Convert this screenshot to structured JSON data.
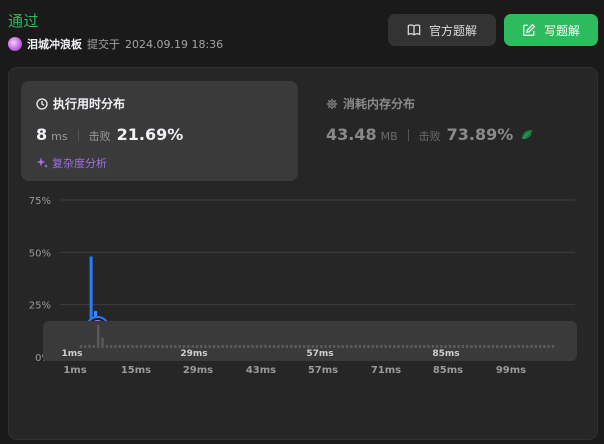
{
  "header": {
    "status": "通过",
    "username": "泪城冲浪板",
    "submitted_label": "提交于",
    "submitted_at": "2024.09.19 18:36",
    "official_solution_label": "官方题解",
    "write_solution_label": "写题解"
  },
  "runtime_card": {
    "title": "执行用时分布",
    "value": "8",
    "unit": "ms",
    "beats_label": "击败",
    "beats_value": "21.69%",
    "complexity_label": "复杂度分析"
  },
  "memory_card": {
    "title": "消耗内存分布",
    "value": "43.48",
    "unit": "MB",
    "beats_label": "击败",
    "beats_value": "73.89%"
  },
  "colors": {
    "accent_green": "#2cbb5d",
    "bar_blue": "#2b7df6",
    "purple": "#a06fe8"
  },
  "chart_data": {
    "type": "bar",
    "title": "",
    "xlabel": "",
    "ylabel": "",
    "y_ticks": [
      "75%",
      "50%",
      "25%",
      "0%"
    ],
    "ylim": [
      0,
      75
    ],
    "x_tick_labels": [
      "1ms",
      "15ms",
      "29ms",
      "43ms",
      "57ms",
      "71ms",
      "85ms",
      "99ms"
    ],
    "x": [
      1,
      2,
      3,
      4,
      5,
      6,
      7,
      8,
      9,
      10,
      11,
      12,
      13,
      14,
      15,
      16,
      17,
      18,
      19,
      20,
      21,
      22,
      23,
      24,
      25,
      26,
      27,
      28,
      29,
      30,
      31,
      32,
      33,
      34,
      35,
      36,
      37,
      38,
      39,
      40,
      41,
      42,
      43,
      44,
      45,
      46,
      47,
      48,
      49,
      50,
      51,
      52,
      53,
      54,
      55,
      56,
      57,
      58,
      59,
      60,
      61,
      62,
      63,
      64,
      65,
      66,
      67,
      68,
      69,
      70,
      71,
      72,
      73,
      74,
      75,
      76,
      77,
      78,
      79,
      80,
      81,
      82,
      83,
      84,
      85,
      86,
      87,
      88,
      89,
      90,
      91,
      92,
      93,
      94,
      95,
      96,
      97,
      98,
      99,
      100,
      101,
      102,
      103,
      104,
      105,
      106,
      107,
      108,
      109,
      110,
      111
    ],
    "values": [
      3,
      6,
      6,
      5,
      48,
      22,
      3,
      2,
      2,
      2,
      2,
      2,
      2,
      2,
      2,
      2,
      2,
      2,
      2,
      2,
      2,
      2,
      2,
      2,
      2,
      2,
      2,
      2,
      2,
      2,
      2,
      2,
      2,
      2,
      2,
      2,
      2,
      2,
      2,
      2,
      2,
      2,
      2,
      2,
      2,
      2,
      2,
      2,
      2,
      2,
      2,
      2,
      2,
      2,
      2,
      2,
      2,
      2,
      2,
      2,
      2,
      2,
      2,
      2,
      2,
      2,
      2,
      2,
      2,
      2,
      2,
      2,
      2,
      2,
      2,
      2,
      2,
      2,
      2,
      2,
      2,
      2,
      2,
      2,
      2,
      2,
      2,
      2,
      2,
      2,
      2,
      2,
      2,
      2,
      2,
      2,
      2,
      2,
      2,
      2,
      2,
      2,
      2,
      2,
      2,
      2,
      2,
      2,
      2,
      2,
      2
    ],
    "highlight_x": 6,
    "grid": true,
    "legend": "none",
    "overview_tick_labels": [
      "1ms",
      "29ms",
      "57ms",
      "85ms"
    ]
  }
}
